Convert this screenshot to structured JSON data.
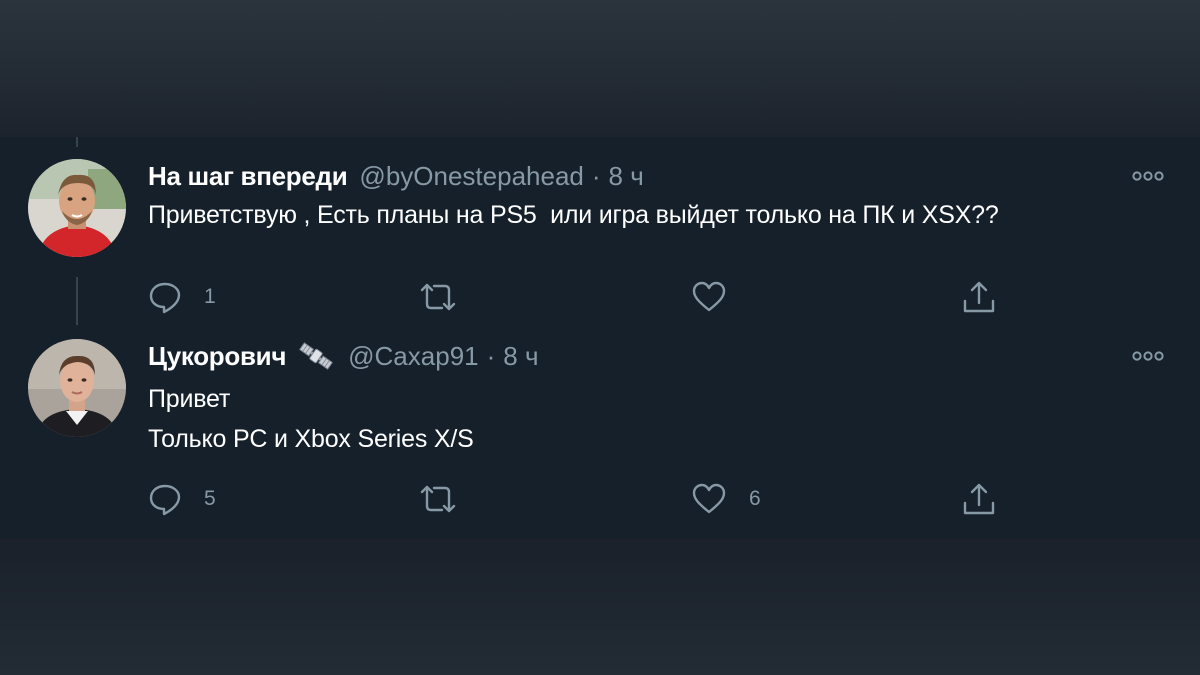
{
  "thread": {
    "tweets": [
      {
        "author_name": "На шаг впереди",
        "handle": "@byOnestepahead",
        "separator": "·",
        "time": "8 ч",
        "text_lines": [
          "Приветствую , Есть планы на PS5  или игра выйдет только на ПК и XSX??"
        ],
        "reply_count": "1",
        "retweet_count": "",
        "like_count": "",
        "avatar_icon": "user-photo-avatar",
        "badge_icon": null
      },
      {
        "author_name": "Цукорович",
        "handle": "@Caxap91",
        "separator": "·",
        "time": "8 ч",
        "text_lines": [
          "Привет",
          "Только PC и Xbox Series X/S"
        ],
        "reply_count": "5",
        "retweet_count": "",
        "like_count": "6",
        "avatar_icon": "user-photo-avatar",
        "badge_icon": "satellite-emoji-icon"
      }
    ]
  },
  "icons": {
    "reply": "reply-icon",
    "retweet": "retweet-icon",
    "like": "heart-icon",
    "share": "share-icon",
    "more": "more-options-icon"
  },
  "colors": {
    "background": "#15202b",
    "primary_text": "#ffffff",
    "secondary_text": "#8899a6",
    "thread_line": "#38444d"
  }
}
